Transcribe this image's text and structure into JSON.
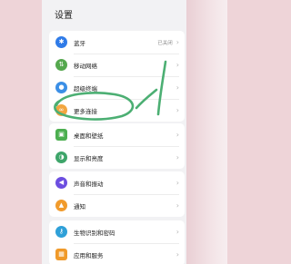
{
  "header": {
    "title": "设置"
  },
  "colors": {
    "bluetooth": "#2f7be8",
    "mobile_network": "#55a84e",
    "super_terminal": "#3b8fe6",
    "more_connections": "#f2a640",
    "desktop_wallpaper": "#4caf50",
    "display": "#3ea56a",
    "sound": "#6c4ee0",
    "notification": "#f19b2c",
    "biometrics": "#2fa0d8",
    "apps": "#f09a2a",
    "annotation_stroke": "#4caf73"
  },
  "groups": [
    {
      "items": [
        {
          "icon": "bluetooth-icon",
          "label": "蓝牙",
          "value": "已关闭"
        },
        {
          "icon": "mobile-network-icon",
          "label": "移动网络"
        },
        {
          "icon": "super-terminal-icon",
          "label": "超级终端"
        },
        {
          "icon": "more-connections-icon",
          "label": "更多连接"
        }
      ]
    },
    {
      "items": [
        {
          "icon": "wallpaper-icon",
          "label": "桌面和壁纸"
        },
        {
          "icon": "display-icon",
          "label": "显示和亮度"
        }
      ]
    },
    {
      "items": [
        {
          "icon": "sound-icon",
          "label": "声音和振动"
        },
        {
          "icon": "notification-icon",
          "label": "通知"
        }
      ]
    },
    {
      "items": [
        {
          "icon": "biometrics-icon",
          "label": "生物识别和密码"
        },
        {
          "icon": "apps-icon",
          "label": "应用和服务"
        }
      ]
    }
  ]
}
